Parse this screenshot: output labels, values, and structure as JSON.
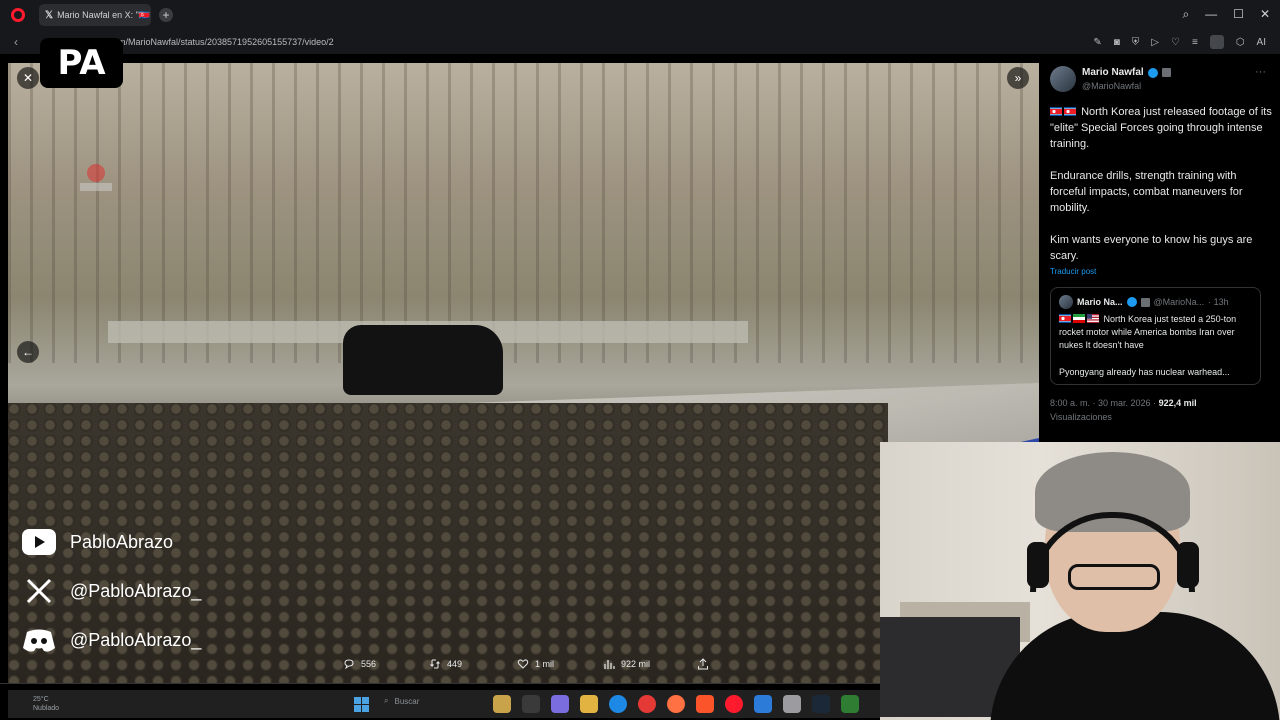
{
  "browser": {
    "tab_title": "Mario Nawfal en X: \"🇰🇵",
    "url": "m/MarioNawfal/status/2038571952605155737/video/2",
    "ai_label": "AI"
  },
  "overlay": {
    "logo_text": "PA",
    "social": [
      {
        "icon": "youtube-icon",
        "label": "PabloAbrazo"
      },
      {
        "icon": "x-logo-icon",
        "label": "@PabloAbrazo_"
      },
      {
        "icon": "discord-icon",
        "label": "@PabloAbrazo_"
      }
    ]
  },
  "stats": {
    "replies": "556",
    "reposts": "449",
    "likes": "1 mil",
    "views": "922 mil"
  },
  "tweet": {
    "author_name": "Mario Nawfal",
    "author_handle": "@MarioNawfal",
    "para1": "North Korea just released footage of its \"elite\" Special Forces going through intense training.",
    "para2": "Endurance drills, strength training with forceful impacts, combat maneuvers for mobility.",
    "para3": "Kim wants everyone to know his guys are scary.",
    "translate": "Traducir post",
    "quote": {
      "name": "Mario Na...",
      "handle": "@MarioNa...",
      "time": "· 13h",
      "text": "North Korea just tested a 250-ton rocket motor while America bombs Iran over nukes It doesn't have",
      "text2": "Pyongyang already has nuclear warhead..."
    },
    "timestamp": "8:00 a. m. · 30 mar. 2026 · ",
    "views_count": "922,4 mil",
    "views_label": "Visualizaciones"
  },
  "taskbar": {
    "temp": "25°C",
    "condition": "Nublado",
    "search_placeholder": "Buscar"
  },
  "colors": {
    "accent": "#1d9bf0",
    "opera_red": "#ff1b2d"
  }
}
